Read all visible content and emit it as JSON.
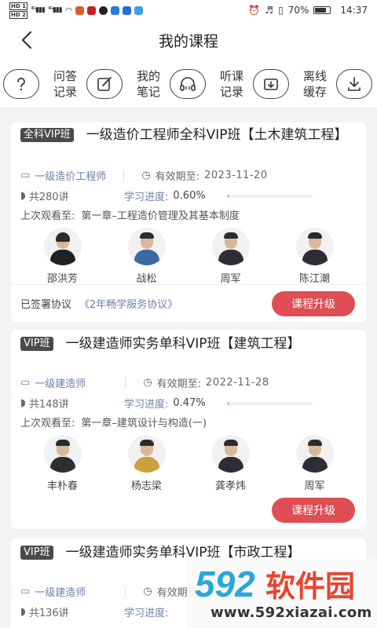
{
  "status": {
    "time": "14:37",
    "battery": "70%"
  },
  "header": {
    "title": "我的课程"
  },
  "quick": [
    {
      "l1": "问答",
      "l2": "记录",
      "icon": "question-icon"
    },
    {
      "l1": "我的",
      "l2": "笔记",
      "icon": "edit-icon"
    },
    {
      "l1": "听课",
      "l2": "记录",
      "icon": "headphones-icon"
    },
    {
      "l1": "离线",
      "l2": "缓存",
      "icon": "download-icon"
    }
  ],
  "cards": [
    {
      "tag": "全科VIP班",
      "title": "一级造价工程师全科VIP班【土木建筑工程】",
      "category": "一级造价工程师",
      "valid_label": "有效期至:",
      "valid_date": "2023-11-20",
      "lessons": "共280讲",
      "progress_label": "学习进度:",
      "progress": "0.60%",
      "progress_value": 0.006,
      "last_label": "上次观看至:",
      "last_chapter": "第一章–工程造价管理及其基本制度",
      "teachers": [
        "邵洪芳",
        "战松",
        "周军",
        "陈江潮"
      ],
      "agreement_label": "已签署协议",
      "agreement_link": "《2年畅学服务协议》",
      "upgrade": "课程升级"
    },
    {
      "tag": "VIP班",
      "title": "一级建造师实务单科VIP班【建筑工程】",
      "category": "一级建造师",
      "valid_label": "有效期至:",
      "valid_date": "2022-11-28",
      "lessons": "共148讲",
      "progress_label": "学习进度:",
      "progress": "0.47%",
      "progress_value": 0.0047,
      "last_label": "上次观看至:",
      "last_chapter": "第一章–建筑设计与构造(一)",
      "teachers": [
        "丰朴春",
        "杨志梁",
        "龚孝炜",
        "周军"
      ],
      "upgrade": "课程升级"
    },
    {
      "tag": "VIP班",
      "title": "一级建造师实务单科VIP班【市政工程】",
      "category": "一级建造师",
      "valid_label": "有效期至:",
      "lessons": "共136讲",
      "progress_label": "学习进度:"
    }
  ],
  "watermark": {
    "brand": "592软件园",
    "url": "www.592xiazai.com"
  },
  "colors": {
    "accent": "#df4d55",
    "link": "#6d7fa8",
    "tag_bg": "#4a4a4a"
  }
}
